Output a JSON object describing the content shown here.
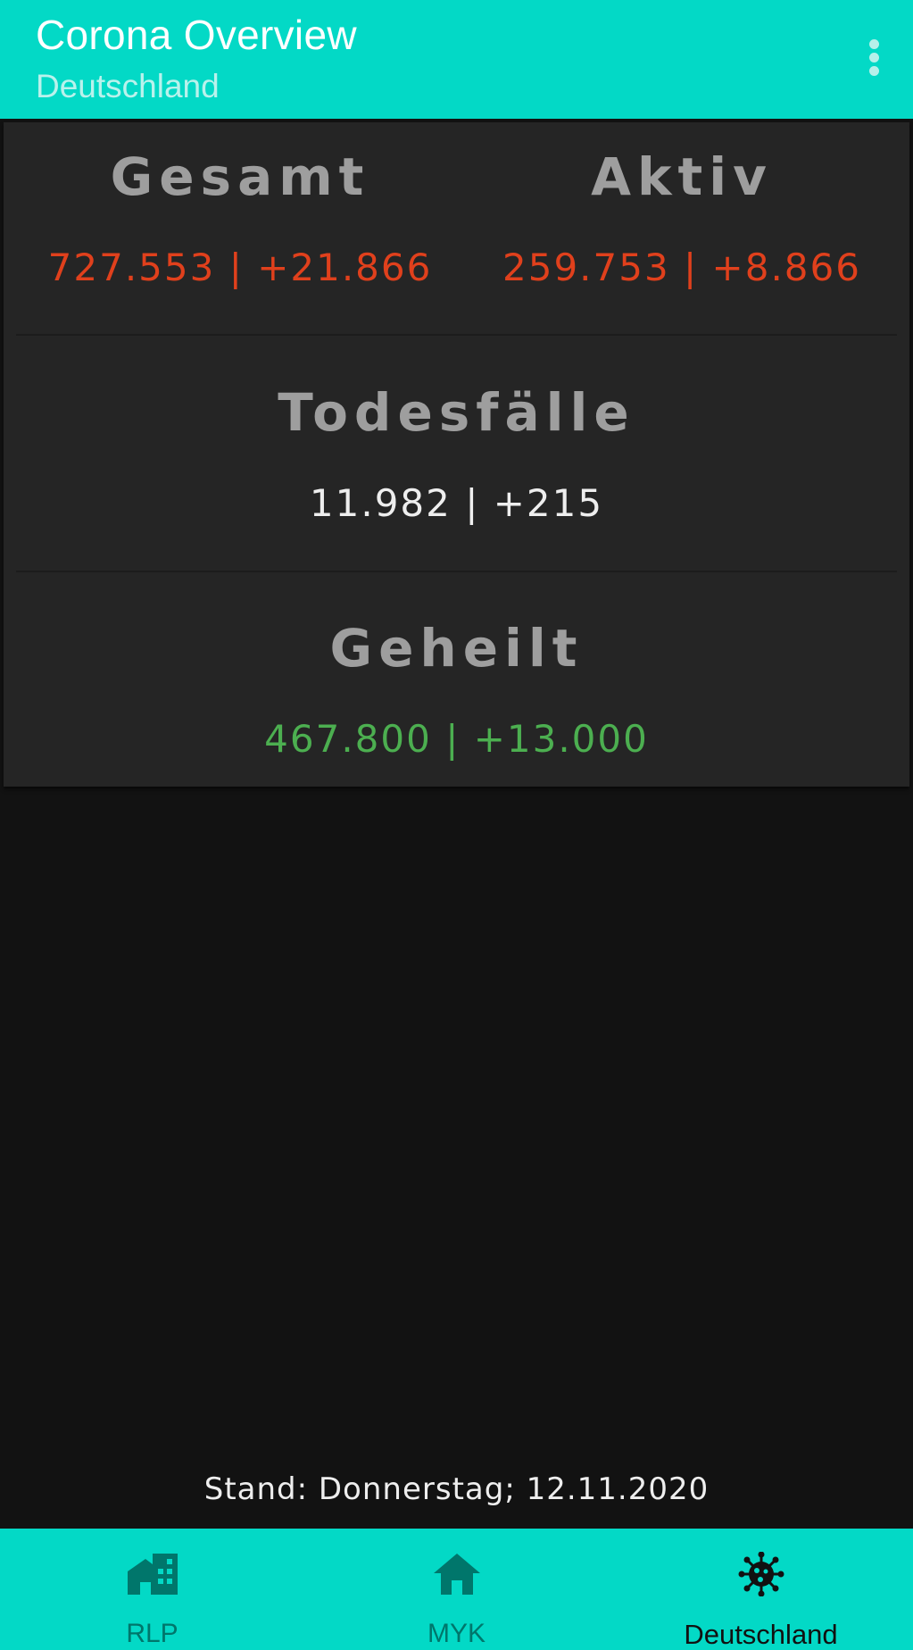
{
  "appbar": {
    "title": "Corona Overview",
    "subtitle": "Deutschland"
  },
  "stats": {
    "gesamt": {
      "title": "Gesamt",
      "value": "727.553 | +21.866"
    },
    "aktiv": {
      "title": "Aktiv",
      "value": "259.753 | +8.866"
    },
    "todesfaelle": {
      "title": "Todesfälle",
      "value": "11.982 | +215"
    },
    "geheilt": {
      "title": "Geheilt",
      "value": "467.800 | +13.000"
    }
  },
  "stand": "Stand: Donnerstag; 12.11.2020",
  "bottomnav": {
    "items": [
      {
        "label": "RLP",
        "icon": "city-icon",
        "active": false
      },
      {
        "label": "MYK",
        "icon": "home-icon",
        "active": false
      },
      {
        "label": "Deutschland",
        "icon": "virus-icon",
        "active": true
      }
    ]
  },
  "colors": {
    "primary": "#03d9c6",
    "negative": "#e0401c",
    "positive": "#4caf50",
    "background": "#121212",
    "card": "#252525"
  }
}
